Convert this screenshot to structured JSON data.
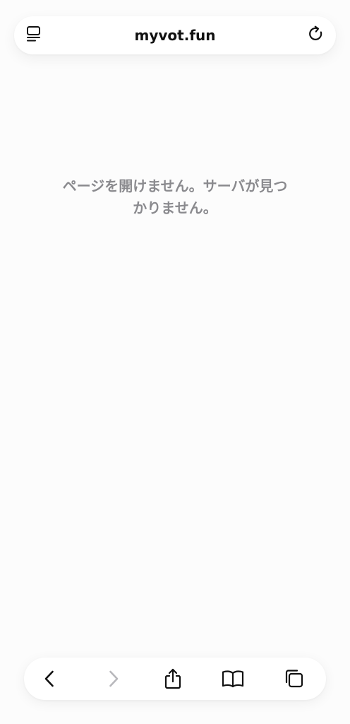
{
  "address_bar": {
    "url": "myvot.fun",
    "left_icon": "page-menu-icon",
    "right_icon": "reload-icon"
  },
  "main": {
    "error_message": "ページを開けません。サーバが見つ\nかりません。"
  },
  "toolbar": {
    "buttons": [
      {
        "icon": "back-icon",
        "enabled": true
      },
      {
        "icon": "forward-icon",
        "enabled": false
      },
      {
        "icon": "share-icon",
        "enabled": true
      },
      {
        "icon": "bookmarks-icon",
        "enabled": true
      },
      {
        "icon": "tabs-icon",
        "enabled": true
      }
    ]
  },
  "colors": {
    "background": "#fcfcfc",
    "bar": "#ffffff",
    "icon": "#111111",
    "disabled_icon": "#b8b8bc",
    "message_text": "#8a8a8e"
  }
}
